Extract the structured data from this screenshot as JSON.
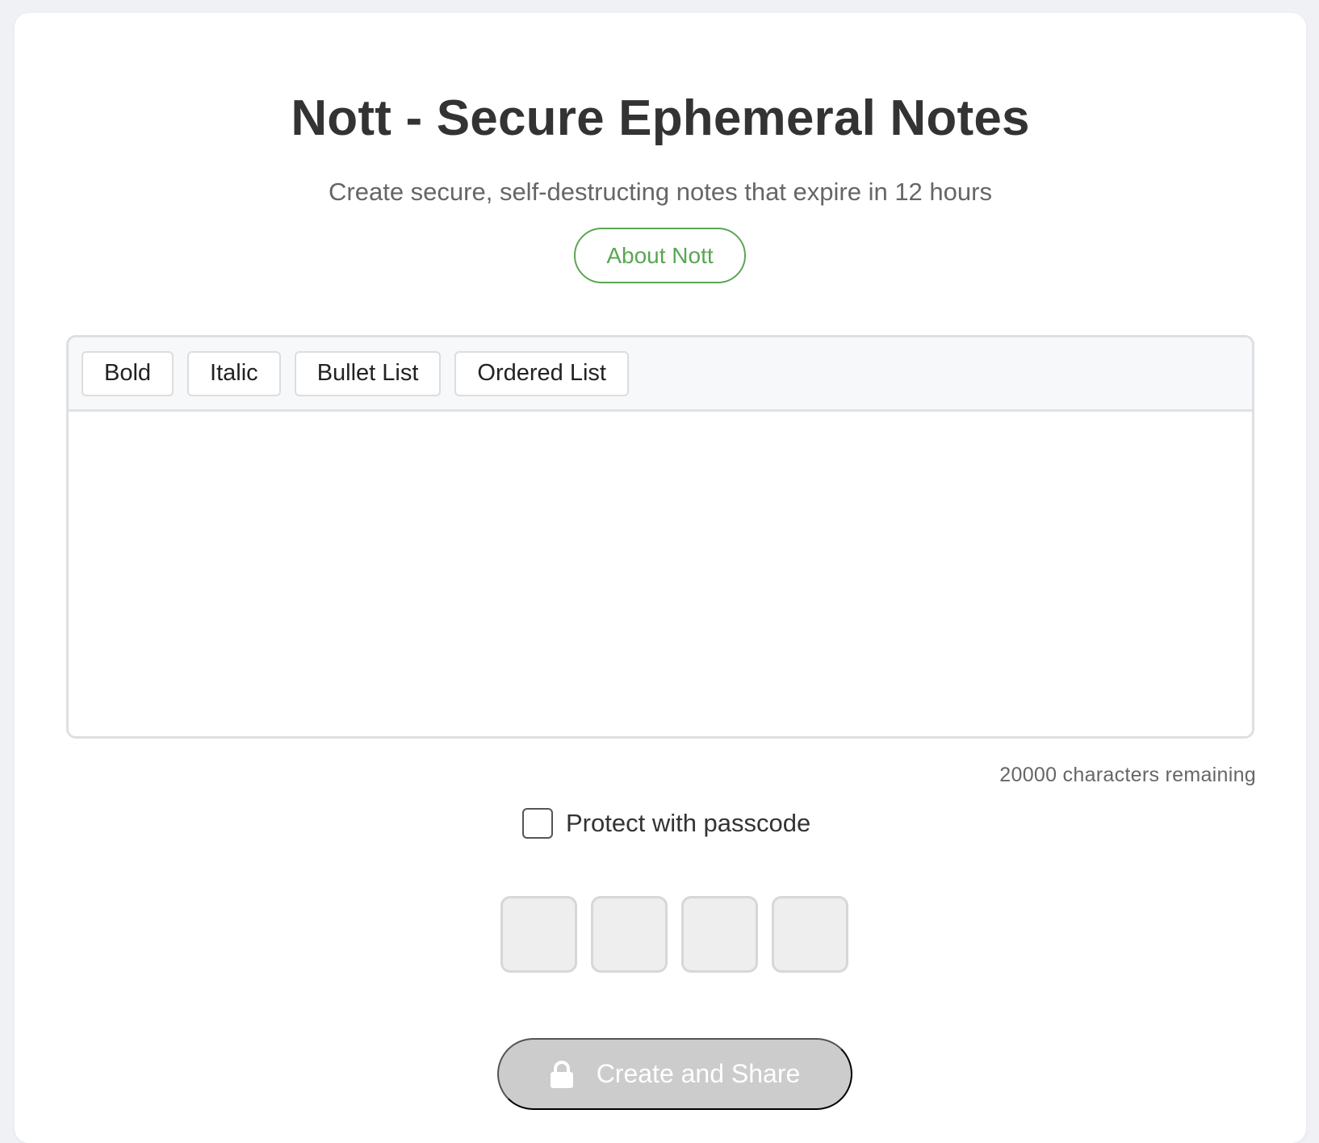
{
  "header": {
    "title": "Nott - Secure Ephemeral Notes",
    "subtitle": "Create secure, self-destructing notes that expire in 12 hours",
    "about_label": "About Nott"
  },
  "editor": {
    "toolbar": {
      "bold_label": "Bold",
      "italic_label": "Italic",
      "bullet_list_label": "Bullet List",
      "ordered_list_label": "Ordered List"
    },
    "content": "",
    "char_count_text": "20000 characters remaining"
  },
  "passcode": {
    "toggle_label": "Protect with passcode",
    "checked": false,
    "digits": [
      "",
      "",
      "",
      ""
    ]
  },
  "actions": {
    "create_label": "Create and Share",
    "create_icon": "lock-icon",
    "create_enabled": false
  },
  "colors": {
    "accent": "#5aa653",
    "disabled_button": "#cccccc",
    "background": "#f0f1f4"
  }
}
